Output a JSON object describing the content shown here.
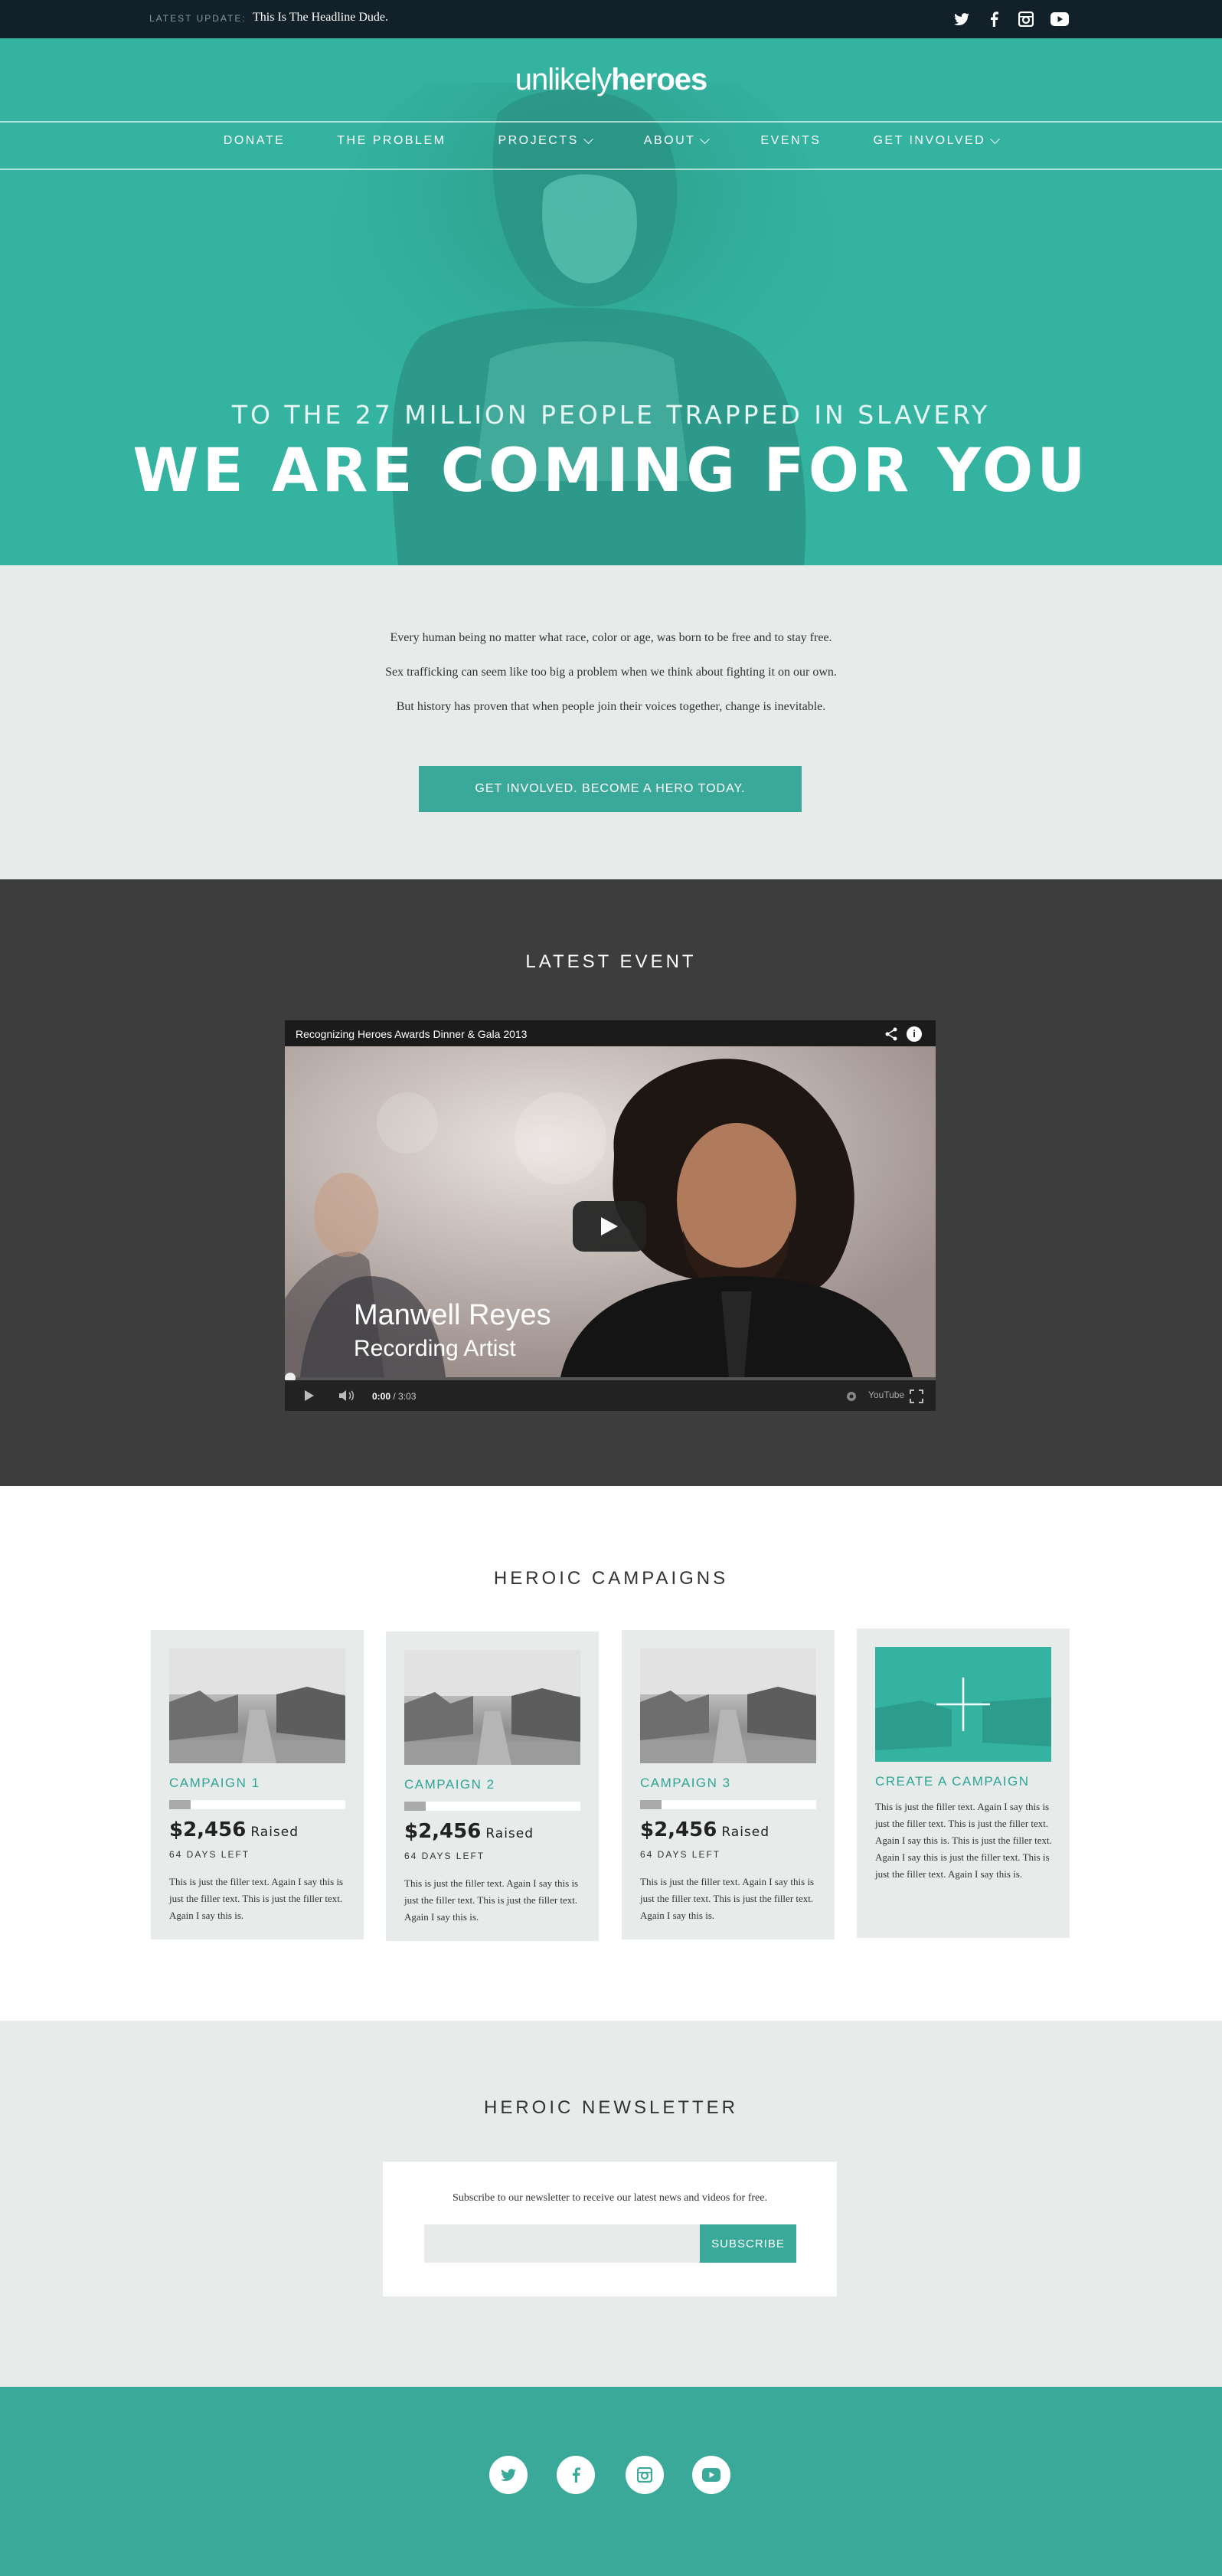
{
  "topbar": {
    "update_label": "LATEST UPDATE:",
    "headline": "This Is The Headline Dude.",
    "social": [
      "twitter-icon",
      "facebook-icon",
      "instagram-icon",
      "youtube-icon"
    ]
  },
  "header": {
    "logo_light": "unlikely",
    "logo_bold": "heroes",
    "nav": [
      {
        "label": "DONATE",
        "dropdown": false
      },
      {
        "label": "THE PROBLEM",
        "dropdown": false
      },
      {
        "label": "PROJECTS",
        "dropdown": true
      },
      {
        "label": "ABOUT",
        "dropdown": true
      },
      {
        "label": "EVENTS",
        "dropdown": false
      },
      {
        "label": "GET INVOLVED",
        "dropdown": true
      }
    ]
  },
  "hero": {
    "subtitle": "TO THE 27 MILLION PEOPLE TRAPPED IN SLAVERY",
    "title": "WE ARE COMING FOR YOU"
  },
  "intro": {
    "lines": [
      "Every human being no matter what race, color or age, was born to be free and to stay free.",
      "Sex trafficking can seem like too big a problem when we think about fighting it on our own.",
      "But history has proven that when people join their voices together, change is inevitable."
    ],
    "cta_label": "GET INVOLVED. BECOME A HERO TODAY."
  },
  "event": {
    "section_title": "LATEST EVENT",
    "video_title": "Recognizing Heroes Awards Dinner & Gala 2013",
    "speaker_name": "Manwell Reyes",
    "speaker_role": "Recording Artist",
    "time_current": "0:00",
    "time_total": "/ 3:03",
    "youtube_label": "YouTube"
  },
  "campaigns": {
    "section_title": "HEROIC CAMPAIGNS",
    "items": [
      {
        "name": "CAMPAIGN 1",
        "amount": "$2,456",
        "raised_label": "Raised",
        "days_left": "64 DAYS LEFT",
        "progress": 0.12,
        "description": "This is just the filler text. Again I say this is just the filler text. This is just the filler text. Again I say this is."
      },
      {
        "name": "CAMPAIGN 2",
        "amount": "$2,456",
        "raised_label": "Raised",
        "days_left": "64 DAYS LEFT",
        "progress": 0.12,
        "description": "This is just the filler text. Again I say this is just the filler text. This is just the filler text. Again I say this is."
      },
      {
        "name": "CAMPAIGN 3",
        "amount": "$2,456",
        "raised_label": "Raised",
        "days_left": "64 DAYS LEFT",
        "progress": 0.12,
        "description": "This is just the filler text. Again I say this is just the filler text. This is just the filler text. Again I say this is."
      }
    ],
    "create": {
      "label": "CREATE A CAMPAIGN",
      "description": "This is just the filler text. Again I say this is just the filler text. This is just the filler text. Again I say this is. This is just the filler text. Again I say this is just the filler text. This is just the filler text. Again I say this is."
    }
  },
  "newsletter": {
    "section_title": "HEROIC NEWSLETTER",
    "text": "Subscribe to our newsletter to receive our latest news and videos for free.",
    "input_value": "",
    "button_label": "SUBSCRIBE"
  },
  "footer": {
    "social": [
      "twitter-icon",
      "facebook-icon",
      "instagram-icon",
      "youtube-icon"
    ]
  },
  "colors": {
    "teal": "#33b3a0",
    "teal_dark": "#3aa999",
    "topbar": "#112029",
    "light_gray": "#e7ebea",
    "dark_gray": "#3d3d3d"
  }
}
